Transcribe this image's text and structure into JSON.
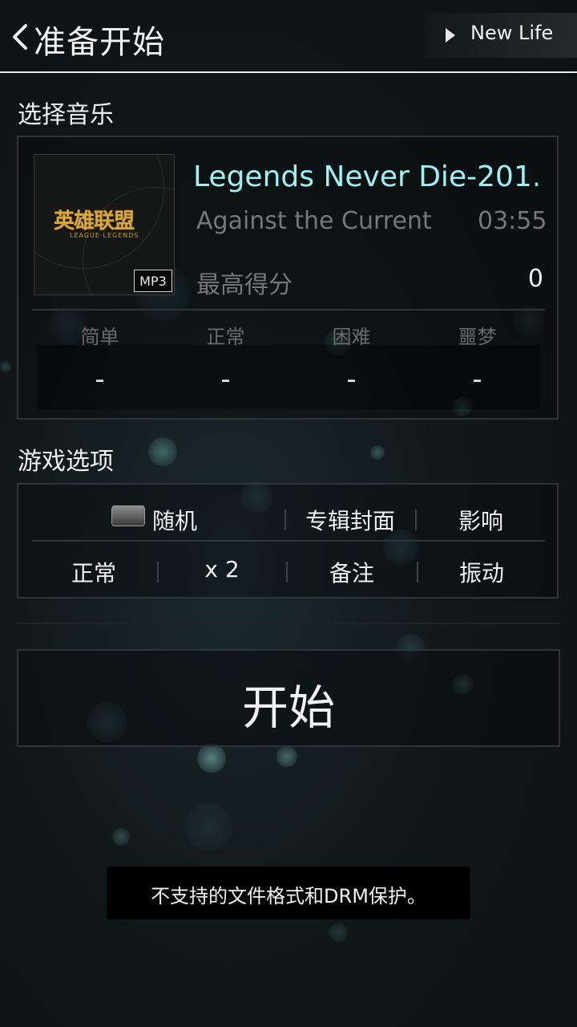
{
  "header": {
    "title": "准备开始",
    "back_icon": "chevron-left-icon",
    "right_button_label": "New Life",
    "right_button_icon": "play-triangle-icon"
  },
  "music_section": {
    "label": "选择音乐",
    "album_cover": {
      "logo_text_cn": "英雄联盟",
      "logo_text_en": "LEAGUE·LEGENDS",
      "format_badge": "MP3"
    },
    "song_title": "Legends Never Die-201…",
    "artist": "Against the Current",
    "duration": "03:55",
    "high_score_label": "最高得分",
    "high_score_value": "0",
    "difficulties": [
      {
        "label": "简单",
        "value": "-"
      },
      {
        "label": "正常",
        "value": "-"
      },
      {
        "label": "困难",
        "value": "-"
      },
      {
        "label": "噩梦",
        "value": "-"
      }
    ]
  },
  "options_section": {
    "label": "游戏选项",
    "row1": [
      {
        "label": "随机",
        "icon": "toggle-switch-icon"
      },
      {
        "label": "专辑封面"
      },
      {
        "label": "影响"
      }
    ],
    "row2": [
      {
        "label": "正常"
      },
      {
        "label": "x 2"
      },
      {
        "label": "备注"
      },
      {
        "label": "振动"
      }
    ]
  },
  "start_button_label": "开始",
  "toast_message": "不支持的文件格式和DRM保护。",
  "colors": {
    "accent_title": "#9ff0f4",
    "background": "#111819",
    "muted_text": "#777777"
  }
}
